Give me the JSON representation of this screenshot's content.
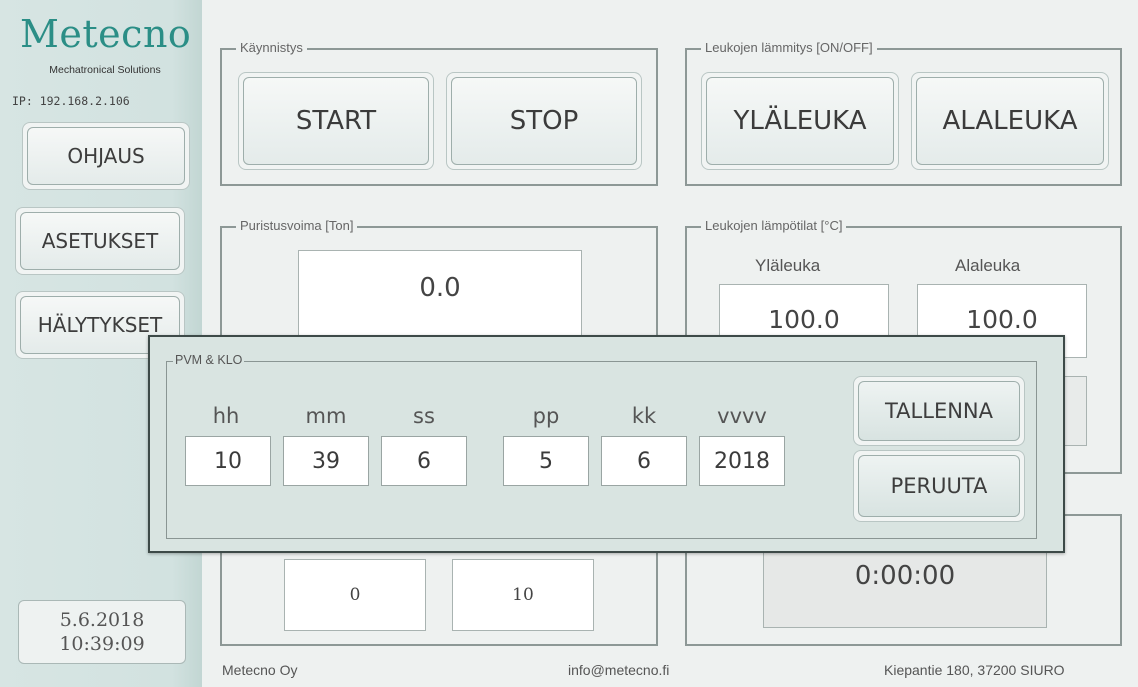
{
  "sidebar": {
    "logo_title": "Metecno",
    "logo_subtitle": "Mechatronical Solutions",
    "ip": "IP: 192.168.2.106",
    "nav": [
      {
        "label": "OHJAUS"
      },
      {
        "label": "ASETUKSET"
      },
      {
        "label": "HÄLYTYKSET"
      }
    ],
    "date": "5.6.2018",
    "time": "10:39:09"
  },
  "kaynnistys": {
    "label": "Käynnistys",
    "start": "START",
    "stop": "STOP"
  },
  "heating": {
    "label": "Leukojen lämmitys [ON/OFF]",
    "upper": "YLÄLEUKA",
    "lower": "ALALEUKA"
  },
  "force": {
    "label": "Puristusvoima [Ton]",
    "value": "0.0"
  },
  "temps": {
    "label": "Leukojen lämpötilat [°C]",
    "upper_label": "Yläleuka",
    "lower_label": "Alaleuka",
    "upper_value": "100.0",
    "lower_value": "100.0"
  },
  "bottom_left": {
    "value1": "0",
    "value2": "10"
  },
  "bottom_right": {
    "timer": "0:00:00"
  },
  "modal": {
    "label": "PVM & KLO",
    "fields": [
      {
        "label": "hh",
        "value": "10"
      },
      {
        "label": "mm",
        "value": "39"
      },
      {
        "label": "ss",
        "value": "6"
      },
      {
        "label": "pp",
        "value": "5"
      },
      {
        "label": "kk",
        "value": "6"
      },
      {
        "label": "vvvv",
        "value": "2018"
      }
    ],
    "save": "TALLENNA",
    "cancel": "PERUUTA"
  },
  "footer": {
    "company": "Metecno Oy",
    "email": "info@metecno.fi",
    "address": "Kiepantie 180, 37200 SIURO"
  }
}
